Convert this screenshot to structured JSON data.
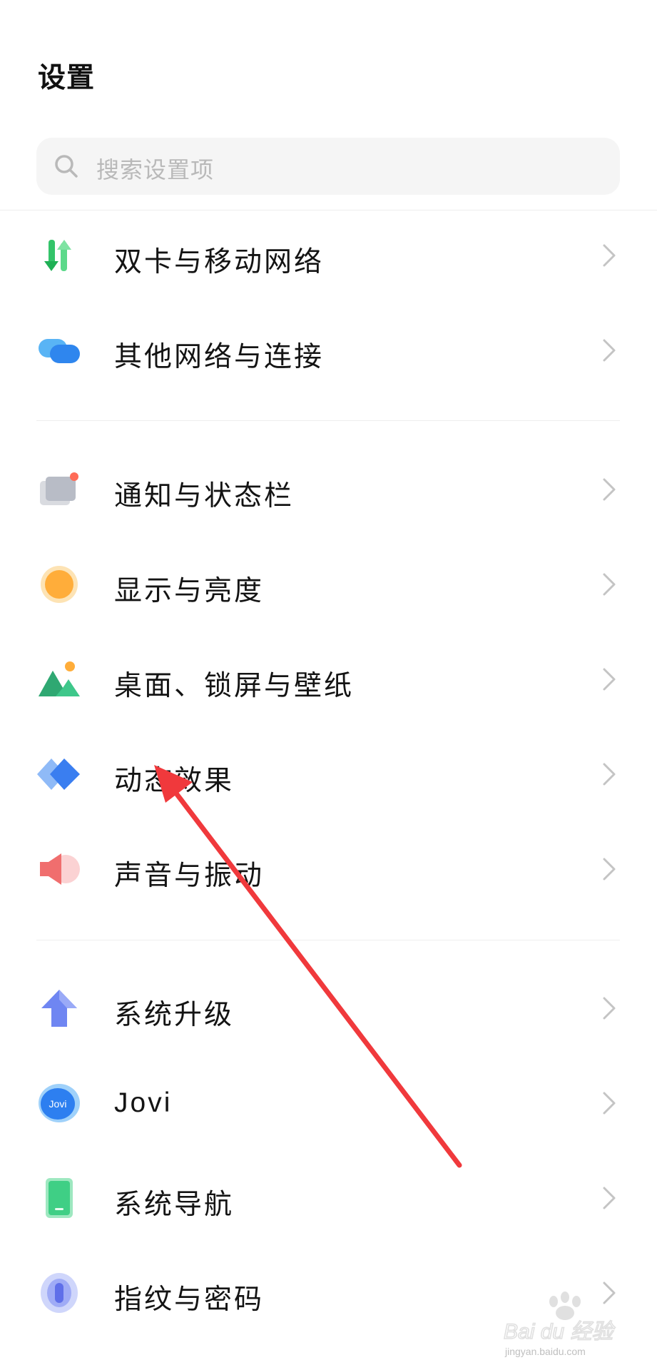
{
  "header": {
    "title": "设置"
  },
  "search": {
    "placeholder": "搜索设置项",
    "icon": "search-icon"
  },
  "items": [
    {
      "label": "双卡与移动网络",
      "icon": "dual-sim-icon"
    },
    {
      "label": "其他网络与连接",
      "icon": "network-connection-icon"
    },
    {
      "label": "通知与状态栏",
      "icon": "notification-icon"
    },
    {
      "label": "显示与亮度",
      "icon": "brightness-icon"
    },
    {
      "label": "桌面、锁屏与壁纸",
      "icon": "wallpaper-icon"
    },
    {
      "label": "动态效果",
      "icon": "animation-icon"
    },
    {
      "label": "声音与振动",
      "icon": "sound-icon"
    },
    {
      "label": "系统升级",
      "icon": "upgrade-icon"
    },
    {
      "label": "Jovi",
      "icon": "jovi-icon",
      "icon_text": "Jovi"
    },
    {
      "label": "系统导航",
      "icon": "navigation-icon"
    },
    {
      "label": "指纹与密码",
      "icon": "fingerprint-icon"
    }
  ],
  "watermark": {
    "text": "Bai du 经验",
    "url": "jingyan.baidu.com"
  },
  "colors": {
    "annotation_arrow": "#f0393c",
    "chevron": "#c4c4c4",
    "divider": "#eeeeee"
  }
}
